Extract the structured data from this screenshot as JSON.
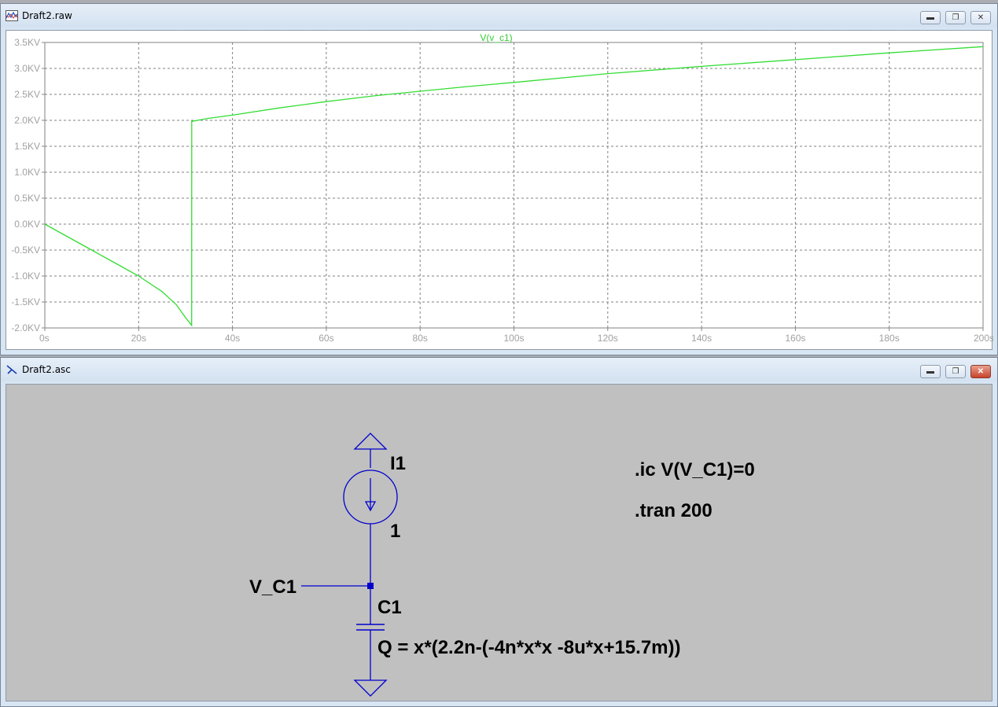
{
  "plot_window": {
    "title": "Draft2.raw",
    "trace_name": "V(v_c1)",
    "y_ticks": [
      "3.5KV",
      "3.0KV",
      "2.5KV",
      "2.0KV",
      "1.5KV",
      "1.0KV",
      "0.5KV",
      "0.0KV",
      "-0.5KV",
      "-1.0KV",
      "-1.5KV",
      "-2.0KV"
    ],
    "x_ticks": [
      "0s",
      "20s",
      "40s",
      "60s",
      "80s",
      "100s",
      "120s",
      "140s",
      "160s",
      "180s",
      "200s"
    ],
    "colors": {
      "trace": "#33dd33",
      "grid": "#808080",
      "axis_text": "#a0a0a0"
    }
  },
  "chart_data": {
    "type": "line",
    "series": [
      {
        "name": "V(v_c1)",
        "x": [
          0,
          5,
          10,
          15,
          20,
          25,
          28,
          30,
          31.3,
          31.31,
          35,
          40,
          50,
          60,
          70,
          80,
          90,
          100,
          120,
          140,
          160,
          180,
          200
        ],
        "y": [
          0,
          -0.25,
          -0.5,
          -0.75,
          -1.0,
          -1.3,
          -1.55,
          -1.8,
          -1.95,
          1.98,
          2.04,
          2.1,
          2.24,
          2.36,
          2.47,
          2.56,
          2.65,
          2.73,
          2.9,
          3.04,
          3.17,
          3.3,
          3.42
        ]
      }
    ],
    "xlabel": "",
    "ylabel": "",
    "xlim": [
      0,
      200
    ],
    "ylim": [
      -2.0,
      3.5
    ],
    "units": {
      "x": "s",
      "y": "KV"
    },
    "grid": true
  },
  "schematic_window": {
    "title": "Draft2.asc",
    "source_label": "I1",
    "source_value": "1",
    "net_label": "V_C1",
    "cap_label": "C1",
    "cap_value": "Q = x*(2.2n-(-4n*x*x -8u*x+15.7m))",
    "directive_ic": ".ic V(V_C1)=0",
    "directive_tran": ".tran 200",
    "colors": {
      "wire": "#0000cc",
      "background": "#c0c0c0"
    }
  }
}
